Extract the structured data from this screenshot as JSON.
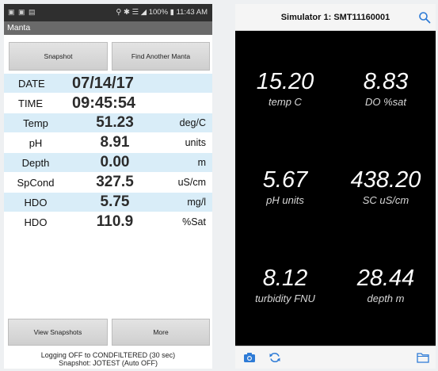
{
  "left_phone": {
    "status_time": "11:43 AM",
    "status_battery": "100%",
    "app_title": "Manta",
    "buttons": {
      "snapshot": "Snapshot",
      "find_another": "Find Another Manta",
      "view_snapshots": "View Snapshots",
      "more": "More"
    },
    "date": {
      "label": "DATE",
      "value": "07/14/17"
    },
    "time": {
      "label": "TIME",
      "value": "09:45:54"
    },
    "readings": [
      {
        "label": "Temp",
        "value": "51.23",
        "unit": "deg/C"
      },
      {
        "label": "pH",
        "value": "8.91",
        "unit": "units"
      },
      {
        "label": "Depth",
        "value": "0.00",
        "unit": "m"
      },
      {
        "label": "SpCond",
        "value": "327.5",
        "unit": "uS/cm"
      },
      {
        "label": "HDO",
        "value": "5.75",
        "unit": "mg/l"
      },
      {
        "label": "HDO",
        "value": "110.9",
        "unit": "%Sat"
      }
    ],
    "log_line_1": "Logging OFF  to CONDFILTERED (30 sec)",
    "log_line_2": "Snapshot: JOTEST (Auto OFF)"
  },
  "right_phone": {
    "title": "Simulator 1: SMT11160001",
    "tiles": [
      {
        "value": "15.20",
        "label": "temp C"
      },
      {
        "value": "8.83",
        "label": "DO %sat"
      },
      {
        "value": "5.67",
        "label": "pH units"
      },
      {
        "value": "438.20",
        "label": "SC uS/cm"
      },
      {
        "value": "8.12",
        "label": "turbidity FNU"
      },
      {
        "value": "28.44",
        "label": "depth m"
      }
    ]
  },
  "colors": {
    "row_blue": "#d9edf8",
    "accent_icon": "#2e7bd6",
    "right_background": "#000000"
  },
  "icons": [
    "search-icon",
    "camera-icon",
    "refresh-icon",
    "folder-icon"
  ]
}
